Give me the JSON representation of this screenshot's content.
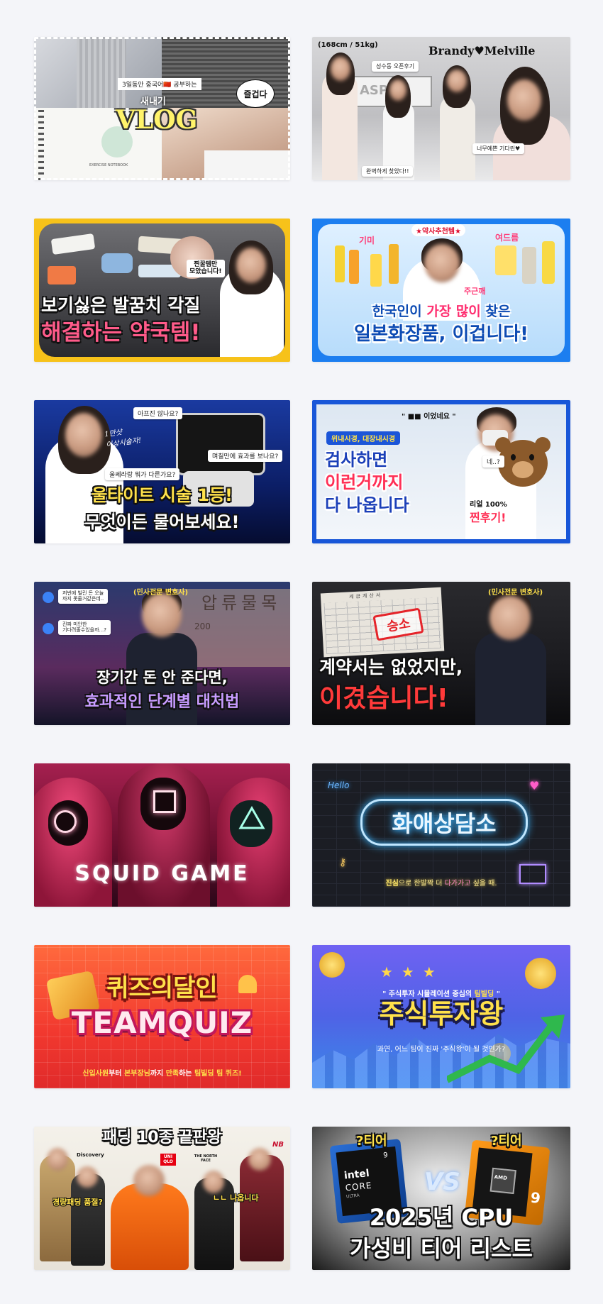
{
  "thumbnails": [
    {
      "id": "vlog",
      "caption": "3일동안 중국어",
      "caption_flag": "🇨🇳",
      "caption_tail": "공부하는",
      "subtitle": "새내기",
      "title": "VLOG",
      "speech": "즐겁다",
      "notebook": "EXERCISE NOTEBOOK"
    },
    {
      "id": "brandy",
      "size": "(168cm / 51kg)",
      "shop": "성수동 오픈후기",
      "brand": "Brandy♥Melville",
      "sign": "ASPEN",
      "cap1": "너무예쁜 기다린♥",
      "cap2": "완벽하게 찾았다!!"
    },
    {
      "id": "heel",
      "tag": "찐꿀템만\n모았습니다!",
      "line1": "보기싫은 발꿈치 각질",
      "line2": "해결하는 약국템!"
    },
    {
      "id": "jp-cosmetics",
      "badge": "★약사추천템★",
      "label1": "기미",
      "label2": "여드름",
      "label3": "주근깨",
      "line1_a": "한국인이 ",
      "line1_b": "가장 많이",
      "line1_c": " 찾은",
      "line2": "일본화장품, 이겁니다!"
    },
    {
      "id": "ultherapy",
      "q1": "아프진 않나요?",
      "q2": "며칠만에 효과를 보나요?",
      "q3": "울쎄라랑 뭐가 다른가요?",
      "handwriting": "1만샷\n이상시술자!",
      "line1": "울타이트 시술 1등!",
      "line2": "무엇이든 물어보세요!"
    },
    {
      "id": "endoscopy",
      "q1": "\" ■■ 이었네요 \"",
      "tag": "위내시경, 대장내시경",
      "bubble": "네..?",
      "line1": "검사하면",
      "line2": "이런거까지",
      "line3": "다 나옵니다",
      "real": "리얼 100%",
      "real2": "찐후기!"
    },
    {
      "id": "lawyer1",
      "badge": "(민사전문 변호사)",
      "chat1": "저번에 빌린 돈 오늘\n까지 못줄거같은데..",
      "chat2": "진짜 미안한\n기다려줄수있을까...?",
      "bg_text": "압류물목",
      "bg_num": "200",
      "line1": "장기간 돈 안 준다면,",
      "line2": "효과적인 단계별 대처법"
    },
    {
      "id": "lawyer2",
      "badge": "(민사전문 변호사)",
      "doc": "세금계산서",
      "stamp": "승소",
      "line1": "계약서는 없었지만,",
      "line2": "이겼습니다!"
    },
    {
      "id": "squid",
      "title": "SQUID GAME"
    },
    {
      "id": "neon",
      "corner": "Hello",
      "title": "화애상담소",
      "sub_a": "진심",
      "sub_b": "으로 한발짝 더 ",
      "sub_c": "다가가고",
      "sub_d": " 싶을 때."
    },
    {
      "id": "teamquiz",
      "line1": "퀴즈의달인",
      "line2": "TEAMQUIZ",
      "sub_a": "신입사원",
      "sub_b": "부터 ",
      "sub_c": "본부장님",
      "sub_d": "까지 ",
      "sub_e": "만족",
      "sub_f": "하는 ",
      "sub_g": "팀빌딩 팀 퀴즈!"
    },
    {
      "id": "stock",
      "top_a": "\" 주식투자 시뮬레이션 중심의 ",
      "top_b": "팀빌딩",
      "top_c": " \"",
      "title": "주식투자왕",
      "sub": "과연, 어느 팀이 진짜 '주식왕'이 될 것인가?"
    },
    {
      "id": "padding",
      "title": "패딩 10종 끝판왕",
      "brand1": "Discovery",
      "brand2": "UNI QLO",
      "brand3": "THE NORTH FACE",
      "brand4": "NB",
      "q": "경량패딩 품절?",
      "ans": "ㄴㄴ 나옵니다"
    },
    {
      "id": "cpu",
      "tier1": "?티어",
      "tier2": "?티어",
      "vs": "VS",
      "chip1_a": "intel",
      "chip1_b": "CORE",
      "chip1_c": "ULTRA",
      "chip1_num": "9",
      "chip2_a": "AMD",
      "chip2_num": "9",
      "line1": "2025년 CPU",
      "line2": "가성비 티어 리스트"
    }
  ],
  "colors": {
    "page_bg": "#f4f5f9",
    "yellow": "#ffe14a",
    "pink": "#ff3c78",
    "blue": "#1b73e8"
  }
}
